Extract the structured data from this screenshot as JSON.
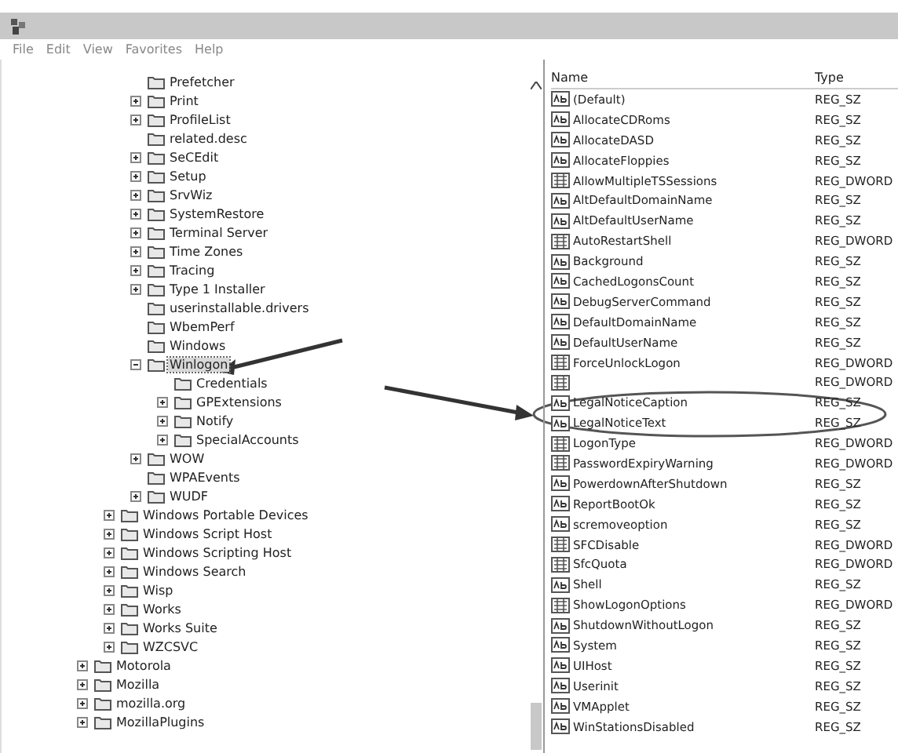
{
  "menu": [
    "File",
    "Edit",
    "View",
    "Favorites",
    "Help"
  ],
  "tree": {
    "items": [
      {
        "children": [
          {
            "children": [
              {
                "label": "Prefetcher",
                "expandable": false,
                "selected": false
              },
              {
                "label": "Print",
                "expandable": true,
                "expanded": false,
                "selected": false
              },
              {
                "label": "ProfileList",
                "expandable": true,
                "expanded": false,
                "selected": false
              },
              {
                "label": "related.desc",
                "expandable": false,
                "selected": false
              },
              {
                "label": "SeCEdit",
                "expandable": true,
                "expanded": false,
                "selected": false
              },
              {
                "label": "Setup",
                "expandable": true,
                "expanded": false,
                "selected": false
              },
              {
                "label": "SrvWiz",
                "expandable": true,
                "expanded": false,
                "selected": false
              },
              {
                "label": "SystemRestore",
                "expandable": true,
                "expanded": false,
                "selected": false
              },
              {
                "label": "Terminal Server",
                "expandable": true,
                "expanded": false,
                "selected": false
              },
              {
                "label": "Time Zones",
                "expandable": true,
                "expanded": false,
                "selected": false
              },
              {
                "label": "Tracing",
                "expandable": true,
                "expanded": false,
                "selected": false
              },
              {
                "label": "Type 1 Installer",
                "expandable": true,
                "expanded": false,
                "selected": false
              },
              {
                "label": "userinstallable.drivers",
                "expandable": false,
                "selected": false
              },
              {
                "label": "WbemPerf",
                "expandable": false,
                "selected": false
              },
              {
                "label": "Windows",
                "expandable": false,
                "selected": false
              },
              {
                "label": "Winlogon",
                "expandable": true,
                "expanded": true,
                "selected": true,
                "children": [
                  {
                    "label": "Credentials",
                    "expandable": false,
                    "selected": false
                  },
                  {
                    "label": "GPExtensions",
                    "expandable": true,
                    "expanded": false,
                    "selected": false
                  },
                  {
                    "label": "Notify",
                    "expandable": true,
                    "expanded": false,
                    "selected": false
                  },
                  {
                    "label": "SpecialAccounts",
                    "expandable": true,
                    "expanded": false,
                    "selected": false
                  }
                ]
              },
              {
                "label": "WOW",
                "expandable": true,
                "expanded": false,
                "selected": false
              },
              {
                "label": "WPAEvents",
                "expandable": false,
                "selected": false
              },
              {
                "label": "WUDF",
                "expandable": true,
                "expanded": false,
                "selected": false
              }
            ]
          },
          {
            "label": "Windows Portable Devices",
            "expandable": true,
            "expanded": false,
            "selected": false
          },
          {
            "label": "Windows Script Host",
            "expandable": true,
            "expanded": false,
            "selected": false
          },
          {
            "label": "Windows Scripting Host",
            "expandable": true,
            "expanded": false,
            "selected": false
          },
          {
            "label": "Windows Search",
            "expandable": true,
            "expanded": false,
            "selected": false
          },
          {
            "label": "Wisp",
            "expandable": true,
            "expanded": false,
            "selected": false
          },
          {
            "label": "Works",
            "expandable": true,
            "expanded": false,
            "selected": false
          },
          {
            "label": "Works Suite",
            "expandable": true,
            "expanded": false,
            "selected": false
          },
          {
            "label": "WZCSVC",
            "expandable": true,
            "expanded": false,
            "selected": false
          }
        ]
      },
      {
        "label": "Motorola",
        "expandable": true,
        "expanded": false,
        "selected": false
      },
      {
        "label": "Mozilla",
        "expandable": true,
        "expanded": false,
        "selected": false
      },
      {
        "label": "mozilla.org",
        "expandable": true,
        "expanded": false,
        "selected": false
      },
      {
        "label": "MozillaPlugins",
        "expandable": true,
        "expanded": false,
        "selected": false
      }
    ]
  },
  "values": {
    "columns": [
      "Name",
      "Type"
    ],
    "rows": [
      {
        "name": "(Default)",
        "type": "REG_SZ",
        "kind": "string"
      },
      {
        "name": "AllocateCDRoms",
        "type": "REG_SZ",
        "kind": "string"
      },
      {
        "name": "AllocateDASD",
        "type": "REG_SZ",
        "kind": "string"
      },
      {
        "name": "AllocateFloppies",
        "type": "REG_SZ",
        "kind": "string"
      },
      {
        "name": "AllowMultipleTSSessions",
        "type": "REG_DWORD",
        "kind": "dword"
      },
      {
        "name": "AltDefaultDomainName",
        "type": "REG_SZ",
        "kind": "string"
      },
      {
        "name": "AltDefaultUserName",
        "type": "REG_SZ",
        "kind": "string"
      },
      {
        "name": "AutoRestartShell",
        "type": "REG_DWORD",
        "kind": "dword"
      },
      {
        "name": "Background",
        "type": "REG_SZ",
        "kind": "string"
      },
      {
        "name": "CachedLogonsCount",
        "type": "REG_SZ",
        "kind": "string"
      },
      {
        "name": "DebugServerCommand",
        "type": "REG_SZ",
        "kind": "string"
      },
      {
        "name": "DefaultDomainName",
        "type": "REG_SZ",
        "kind": "string"
      },
      {
        "name": "DefaultUserName",
        "type": "REG_SZ",
        "kind": "string"
      },
      {
        "name": "ForceUnlockLogon",
        "type": "REG_DWORD",
        "kind": "dword"
      },
      {
        "type": "REG_DWORD",
        "kind": "dword"
      },
      {
        "name": "LegalNoticeCaption",
        "type": "REG_SZ",
        "kind": "string"
      },
      {
        "name": "LegalNoticeText",
        "type": "REG_SZ",
        "kind": "string"
      },
      {
        "name": "LogonType",
        "type": "REG_DWORD",
        "kind": "dword"
      },
      {
        "name": "PasswordExpiryWarning",
        "type": "REG_DWORD",
        "kind": "dword"
      },
      {
        "name": "PowerdownAfterShutdown",
        "type": "REG_SZ",
        "kind": "string"
      },
      {
        "name": "ReportBootOk",
        "type": "REG_SZ",
        "kind": "string"
      },
      {
        "name": "scremoveoption",
        "type": "REG_SZ",
        "kind": "string"
      },
      {
        "name": "SFCDisable",
        "type": "REG_DWORD",
        "kind": "dword"
      },
      {
        "name": "SfcQuota",
        "type": "REG_DWORD",
        "kind": "dword"
      },
      {
        "name": "Shell",
        "type": "REG_SZ",
        "kind": "string"
      },
      {
        "name": "ShowLogonOptions",
        "type": "REG_DWORD",
        "kind": "dword"
      },
      {
        "name": "ShutdownWithoutLogon",
        "type": "REG_SZ",
        "kind": "string"
      },
      {
        "name": "System",
        "type": "REG_SZ",
        "kind": "string"
      },
      {
        "name": "UIHost",
        "type": "REG_SZ",
        "kind": "string"
      },
      {
        "name": "Userinit",
        "type": "REG_SZ",
        "kind": "string"
      },
      {
        "name": "VMApplet",
        "type": "REG_SZ",
        "kind": "string"
      },
      {
        "name": "WinStationsDisabled",
        "type": "REG_SZ",
        "kind": "string"
      }
    ]
  }
}
